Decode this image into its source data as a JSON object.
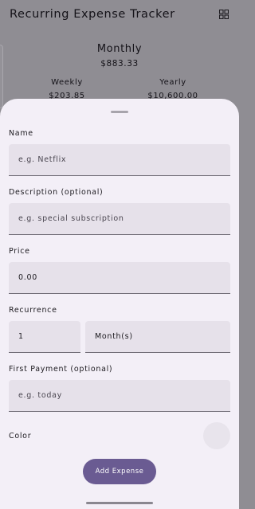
{
  "app_bar": {
    "title": "Recurring Expense Tracker",
    "view_toggle_icon": "grid-icon"
  },
  "summary": {
    "main_label": "Monthly",
    "main_value": "$883.33",
    "weekly_label": "Weekly",
    "weekly_value": "$203.85",
    "yearly_label": "Yearly",
    "yearly_value": "$10,600.00"
  },
  "sheet": {
    "name_label": "Name",
    "name_placeholder": "e.g. Netflix",
    "description_label": "Description (optional)",
    "description_placeholder": "e.g. special subscription",
    "price_label": "Price",
    "price_value": "0.00",
    "recurrence_label": "Recurrence",
    "recurrence_count": "1",
    "recurrence_unit": "Month(s)",
    "first_payment_label": "First Payment (optional)",
    "first_payment_placeholder": "e.g. today",
    "color_label": "Color",
    "add_button_label": "Add Expense"
  },
  "colors": {
    "scrim": "#8f8d93",
    "sheet_background": "#f3eff7",
    "field_background": "#e6e1ea",
    "primary_button": "#6a5b92"
  }
}
